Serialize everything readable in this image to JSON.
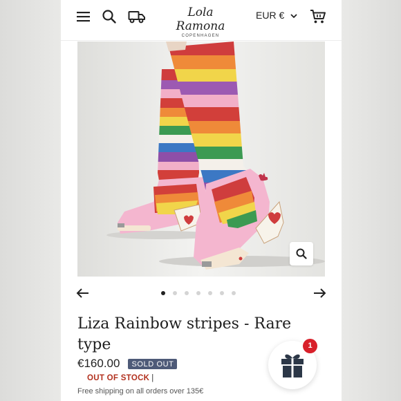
{
  "header": {
    "logo_main": "Lola Ramona",
    "logo_sub": "COPENHAGEN",
    "currency": "EUR €",
    "icons": [
      "menu-icon",
      "search-icon",
      "delivery-truck-icon",
      "chevron-down-icon",
      "cart-icon"
    ]
  },
  "gallery": {
    "image_label": "pink rainbow-striped knee-high clog boots with red heart heels",
    "slide_count": 7,
    "active_slide": 1
  },
  "product": {
    "title": "Liza Rainbow stripes - Rare type",
    "price": "€160.00",
    "badge": "SOLD OUT",
    "stock": "OUT OF STOCK",
    "stock_separator": "|",
    "shipping_note": "Free shipping on all orders over 135€"
  },
  "gift": {
    "count": "1"
  },
  "colors": {
    "badge_bg": "#4e5a78",
    "stock_text": "#b2301e",
    "notification": "#d8202a",
    "boot_pink": "#f4b6cf"
  }
}
